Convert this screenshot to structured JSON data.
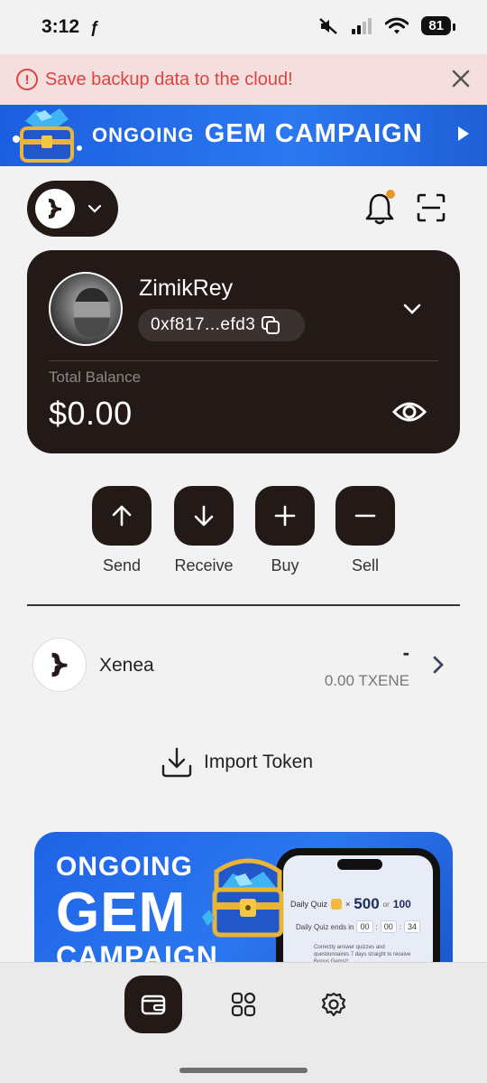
{
  "status_bar": {
    "time": "3:12",
    "app_glyph": "ƒ",
    "battery": "81"
  },
  "backup_banner": {
    "text": "Save backup data to the cloud!"
  },
  "campaign_banner": {
    "small": "ONGOING",
    "big": "GEM CAMPAIGN"
  },
  "wallet": {
    "name": "ZimikRey",
    "address": "0xf817...efd3",
    "balance_label": "Total Balance",
    "balance": "$0.00"
  },
  "actions": [
    {
      "label": "Send",
      "icon": "arrow-up-icon"
    },
    {
      "label": "Receive",
      "icon": "arrow-down-icon"
    },
    {
      "label": "Buy",
      "icon": "plus-icon"
    },
    {
      "label": "Sell",
      "icon": "minus-icon"
    }
  ],
  "tokens": [
    {
      "name": "Xenea",
      "fiat": "-",
      "amount": "0.00 TXENE"
    }
  ],
  "import_token": {
    "label": "Import Token"
  },
  "promo": {
    "line1": "ONGOING",
    "line2": "GEM",
    "line3": "CAMPAIGN",
    "quiz_title": "Daily Quiz",
    "quiz_times": "×",
    "quiz_amount": "500",
    "quiz_or": "or",
    "quiz_alt": "100",
    "quiz_ends": "Daily Quiz ends in",
    "quiz_h": "00",
    "quiz_m": "00",
    "quiz_s": "34",
    "quiz_desc": "Correctly answer quizzes and questionnaires 7 days straight to receive Bonus Gems!!"
  },
  "colors": {
    "accent_dark": "#231a17",
    "alert_red": "#e0433e",
    "brand_blue": "#2b78f0",
    "notification": "#e8962a"
  },
  "tab_bar": {
    "active": "wallet",
    "tabs": [
      "wallet-icon",
      "apps-grid-icon",
      "settings-gear-icon"
    ]
  }
}
